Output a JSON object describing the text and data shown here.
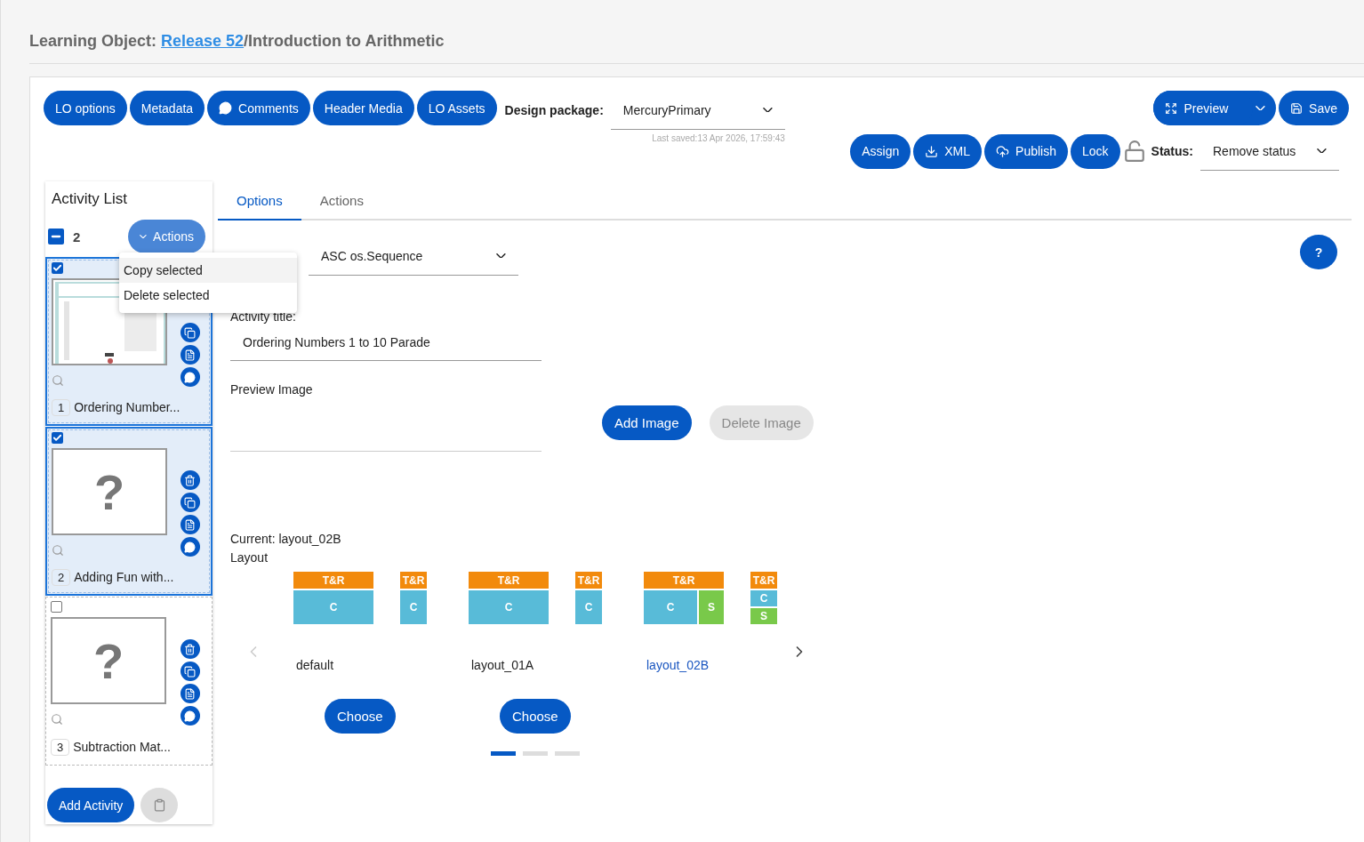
{
  "page_title": {
    "prefix": "Learning Object: ",
    "link": "Release 52",
    "suffix": "/Introduction to Arithmetic"
  },
  "toolbar": {
    "buttons": [
      {
        "label": "LO options",
        "kind": "plain"
      },
      {
        "label": "Metadata",
        "kind": "plain"
      },
      {
        "label": "Comments",
        "kind": "comment"
      },
      {
        "label": "Header Media",
        "kind": "plain"
      },
      {
        "label": "LO Assets",
        "kind": "plain"
      }
    ],
    "design_package": {
      "label": "Design package:",
      "value": "MercuryPrimary",
      "last_saved": "Last saved:13 Apr 2026, 17:59:43"
    },
    "preview": "Preview",
    "save": "Save",
    "actions": [
      {
        "label": "Assign",
        "kind": "plain"
      },
      {
        "label": "XML",
        "kind": "download"
      },
      {
        "label": "Publish",
        "kind": "upload"
      },
      {
        "label": "Lock",
        "kind": "plain"
      }
    ],
    "locked": false,
    "status": {
      "label": "Status:",
      "value": "Remove status"
    }
  },
  "activity_list": {
    "title": "Activity List",
    "selected_count": "2",
    "select_all": {
      "checked": true,
      "indeterminate": true
    },
    "actions_button": "Actions",
    "actions_menu": {
      "open": true,
      "items": [
        {
          "label": "Copy selected",
          "highlighted": true
        },
        {
          "label": "Delete selected",
          "highlighted": false
        }
      ]
    },
    "items": [
      {
        "number": "1",
        "title": "Ordering Number...",
        "checked": true
      },
      {
        "number": "2",
        "title": "Adding Fun with...",
        "checked": true,
        "thumbnail": {
          "kind": "placeholder",
          "mark": "?"
        }
      },
      {
        "number": "3",
        "title": "Subtraction Mat...",
        "checked": false,
        "thumbnail": {
          "kind": "placeholder",
          "mark": "?"
        }
      }
    ],
    "add_button": "Add Activity"
  },
  "tabs": [
    {
      "label": "Options",
      "selected": true
    },
    {
      "label": "Actions",
      "selected": false
    }
  ],
  "help_button": "?",
  "form": {
    "type_value": "ASC os.Sequence",
    "title_label": "Activity title:",
    "title_value": "Ordering Numbers 1 to 10 Parade",
    "preview_label": "Preview Image",
    "add_image": "Add Image",
    "delete_image": {
      "label": "Delete Image",
      "disabled": true
    },
    "current_layout": "Current: layout_02B",
    "layout_label": "Layout",
    "layouts": [
      {
        "name": "default",
        "selected": false,
        "choose": "Choose",
        "previews": [
          {
            "kind": "wide",
            "header": "T&R",
            "content": "C"
          },
          {
            "kind": "narrow",
            "header": "T&R",
            "content": "C"
          }
        ]
      },
      {
        "name": "layout_01A",
        "selected": false,
        "choose": "Choose",
        "previews": [
          {
            "kind": "wide",
            "header": "T&R",
            "content": "C"
          },
          {
            "kind": "narrow",
            "header": "T&R",
            "content": "C"
          }
        ]
      },
      {
        "name": "layout_02B",
        "selected": true,
        "previews": [
          {
            "kind": "wide",
            "header": "T&R",
            "content": "C",
            "side": "S"
          },
          {
            "kind": "narrow",
            "header": "T&R",
            "content": "C",
            "side": "S"
          }
        ]
      }
    ],
    "pages": [
      {
        "selected": true
      },
      {
        "selected": false
      },
      {
        "selected": false
      }
    ]
  }
}
